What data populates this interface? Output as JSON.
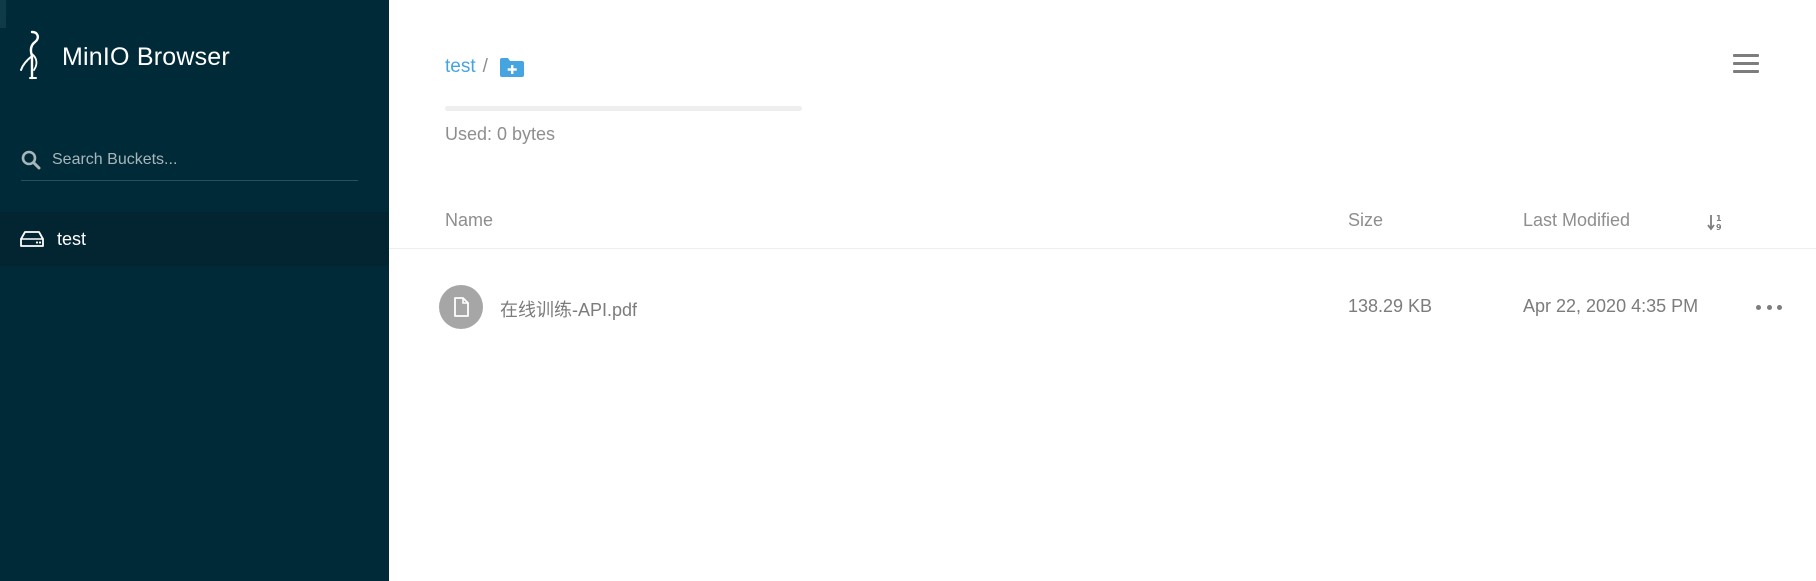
{
  "sidebar": {
    "title": "MinIO Browser",
    "search": {
      "placeholder": "Search Buckets...",
      "value": ""
    },
    "buckets": [
      {
        "label": "test",
        "active": true
      }
    ]
  },
  "main": {
    "breadcrumb": {
      "bucket": "test",
      "separator": "/"
    },
    "usage": {
      "text": "Used: 0 bytes",
      "fraction": 0
    },
    "table": {
      "columns": {
        "name": "Name",
        "size": "Size",
        "modified": "Last Modified"
      },
      "rows": [
        {
          "name": "在线训练-API.pdf",
          "size": "138.29 KB",
          "modified": "Apr 22, 2020 4:35 PM"
        }
      ]
    }
  },
  "icons": {
    "logo": "minio-bird-icon",
    "search": "search-icon",
    "bucket": "hard-drive-icon",
    "add_folder": "folder-plus-icon",
    "menu": "hamburger-menu-icon",
    "sort": "sort-icon",
    "file": "file-icon",
    "row_actions": "more-horizontal-icon"
  },
  "colors": {
    "sidebar_bg": "#002a37",
    "accent": "#46a5e0",
    "text_muted": "#8e8e8e"
  }
}
